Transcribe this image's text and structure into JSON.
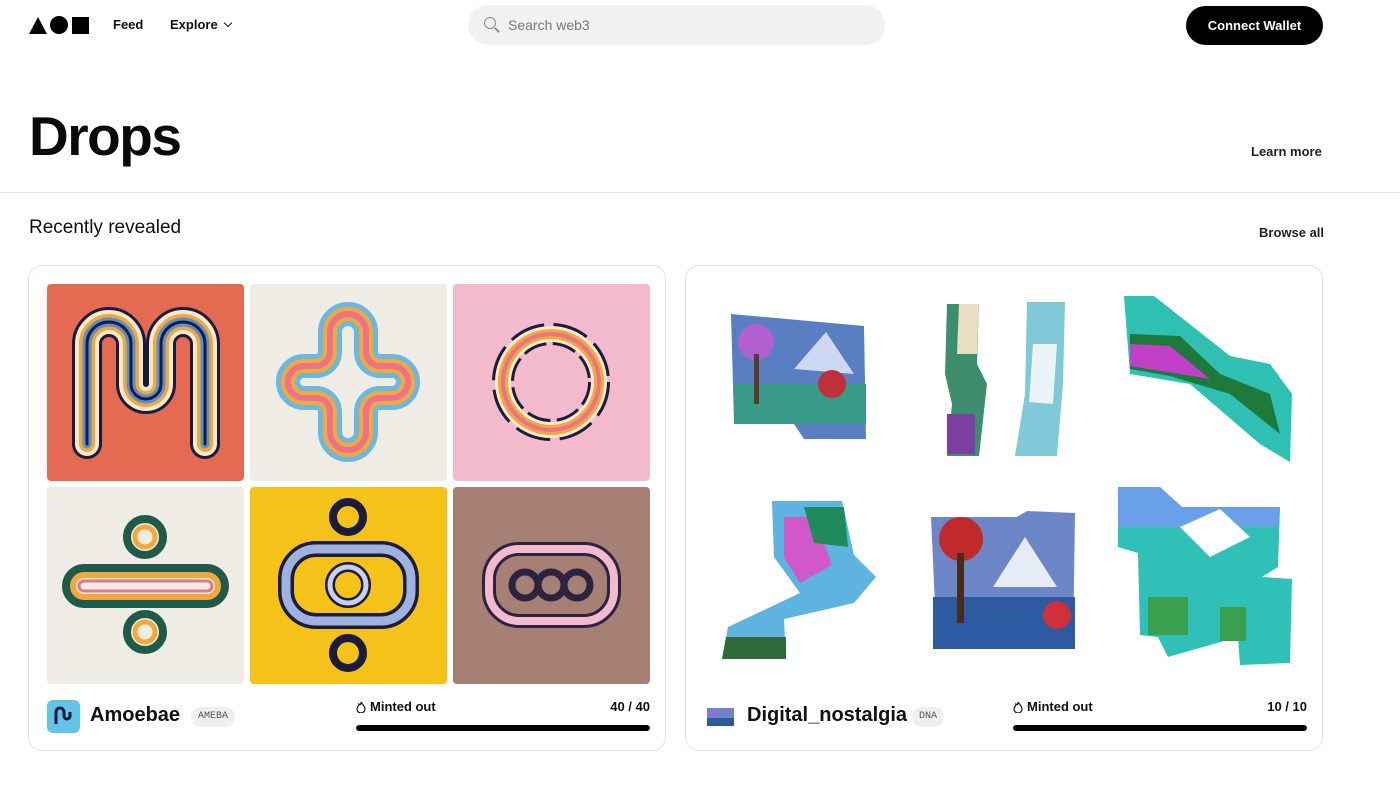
{
  "header": {
    "logo_label": "",
    "nav": {
      "feed": "Feed",
      "explore": "Explore"
    },
    "search": {
      "placeholder": "Search web3",
      "value": ""
    },
    "connect_wallet": "Connect Wallet"
  },
  "hero": {
    "title": "Drops",
    "learn_more": "Learn more"
  },
  "section": {
    "title": "Recently revealed",
    "browse_all": "Browse all"
  },
  "cards": [
    {
      "name": "Amoebae",
      "symbol": "AMEBA",
      "status": "Minted out",
      "minted": "40 / 40",
      "progress": 1.0
    },
    {
      "name": "Digital_nostalgia",
      "symbol": "DNA",
      "status": "Minted out",
      "minted": "10 / 10",
      "progress": 1.0
    }
  ],
  "colors": {
    "accent": "#000000",
    "search_bg": "#f1f1f1",
    "tile_red": "#e56a52",
    "tile_pink": "#f3b9cc",
    "tile_yellow": "#f5c21a",
    "tile_brown": "#a67f75",
    "tile_cream": "#efece6"
  },
  "icons": {
    "search": "search-icon",
    "chevron": "chevron-down-icon",
    "minted": "flame-icon"
  }
}
